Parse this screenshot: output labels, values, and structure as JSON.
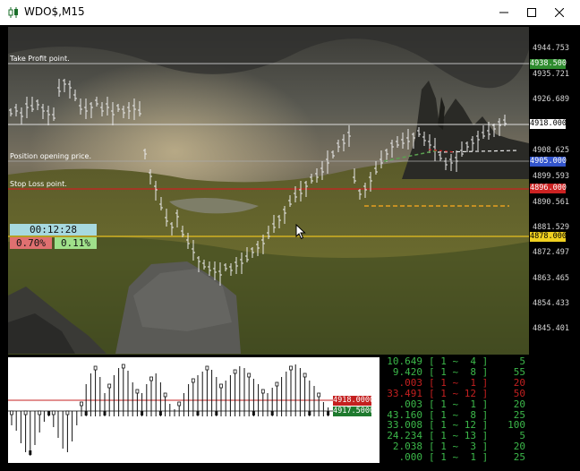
{
  "window": {
    "title": "WDO$,M15",
    "minimize_icon": "minimize-icon",
    "maximize_icon": "maximize-icon",
    "close_icon": "close-icon"
  },
  "chart": {
    "annotations": {
      "take_profit": "Take Profit point.",
      "position_opening": "Position opening price.",
      "stop_loss": "Stop Loss point."
    },
    "countdown": "00:12:28",
    "change_down": "0.70%",
    "change_up": "0.11%"
  },
  "price_scale": {
    "ticks": [
      "4944.753",
      "4935.721",
      "4926.689",
      "4908.625",
      "4899.593",
      "4890.561",
      "4881.529",
      "4872.497",
      "4863.465",
      "4854.433",
      "4845.401"
    ],
    "tags": {
      "take_profit": "4938.500",
      "current": "4918.000",
      "open": "4905.000",
      "stop_loss": "4896.000",
      "low": "4878.000"
    }
  },
  "sub_window": {
    "tags": {
      "upper": "4918.0000",
      "lower": "4917.5000"
    }
  },
  "order_book": {
    "rows": [
      {
        "price": "10.649",
        "range": "[ 1 ~  4 ]",
        "volume": "5",
        "side": "buy"
      },
      {
        "price": "9.420",
        "range": "[ 1 ~  8 ]",
        "volume": "55",
        "side": "buy"
      },
      {
        "price": ".003",
        "range": "[ 1 ~  1 ]",
        "volume": "20",
        "side": "sell"
      },
      {
        "price": "33.491",
        "range": "[ 1 ~ 12 ]",
        "volume": "50",
        "side": "sell"
      },
      {
        "price": ".003",
        "range": "[ 1 ~  1 ]",
        "volume": "20",
        "side": "buy"
      },
      {
        "price": "43.160",
        "range": "[ 1 ~  8 ]",
        "volume": "25",
        "side": "buy"
      },
      {
        "price": "33.008",
        "range": "[ 1 ~ 12 ]",
        "volume": "100",
        "side": "buy"
      },
      {
        "price": "24.234",
        "range": "[ 1 ~ 13 ]",
        "volume": "5",
        "side": "buy"
      },
      {
        "price": "2.038",
        "range": "[ 1 ~  3 ]",
        "volume": "20",
        "side": "buy"
      },
      {
        "price": ".000",
        "range": "[ 1 ~  1 ]",
        "volume": "25",
        "side": "buy"
      }
    ]
  },
  "colors": {
    "take_profit": "#2e8b2e",
    "current": "#ffffff",
    "open": "#3355cc",
    "stop_loss": "#cc2222",
    "low": "#f0d020",
    "book_buy": "#3cb84a",
    "book_sell": "#c42020",
    "timer_bg": "#a7d9e0",
    "down_bg": "#e07070",
    "up_bg": "#9fe08a"
  }
}
